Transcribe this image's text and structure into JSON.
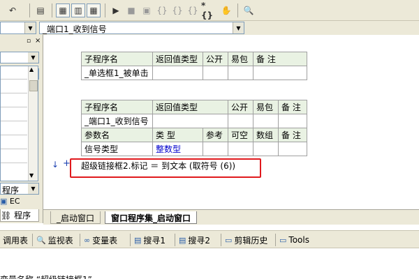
{
  "toolbar": {
    "icons": [
      "undo-icon",
      "table-icon",
      "layout-icon",
      "grid-icon",
      "run-icon",
      "stop-icon",
      "debug-icon",
      "step-into-icon",
      "step-over-icon",
      "step-out-icon",
      "braces-icon",
      "hand-icon",
      "find-icon"
    ]
  },
  "combo": {
    "left_value": "",
    "right_value": "_端口1_收到信号"
  },
  "left_panel": {
    "bottom_select": "程序",
    "tab_ec": "EC",
    "tab_program": "程序"
  },
  "table1": {
    "headers": [
      "子程序名",
      "返回值类型",
      "公开",
      "易包",
      "备 注"
    ],
    "row": [
      "_单选框1_被单击",
      "",
      "",
      "",
      ""
    ]
  },
  "table2": {
    "headers": [
      "子程序名",
      "返回值类型",
      "公开",
      "易包",
      "备 注"
    ],
    "row": [
      "_端口1_收到信号",
      "",
      "",
      "",
      ""
    ],
    "param_headers": [
      "参数名",
      "类 型",
      "参考",
      "可空",
      "数组",
      "备 注"
    ],
    "param_row": [
      "信号类型",
      "整数型",
      "",
      "",
      "",
      ""
    ]
  },
  "code_line": {
    "text": "超级链接框2.标记 ＝ 到文本 (取符号 (6))"
  },
  "doc_tabs": {
    "tab1": "_启动窗口",
    "tab2": "窗口程序集_启动窗口"
  },
  "bottom_tabs": [
    {
      "label": "调用表",
      "icon": "call-table-icon"
    },
    {
      "label": "监视表",
      "icon": "magnifier-icon"
    },
    {
      "label": "变量表",
      "icon": "variables-icon"
    },
    {
      "label": "搜寻1",
      "icon": "search1-icon"
    },
    {
      "label": "搜寻2",
      "icon": "search2-icon"
    },
    {
      "label": "剪辑历史",
      "icon": "clipboard-icon"
    },
    {
      "label": "Tools",
      "icon": "window-icon"
    }
  ],
  "status": {
    "text": "变量名称 “超级链接框1”"
  }
}
